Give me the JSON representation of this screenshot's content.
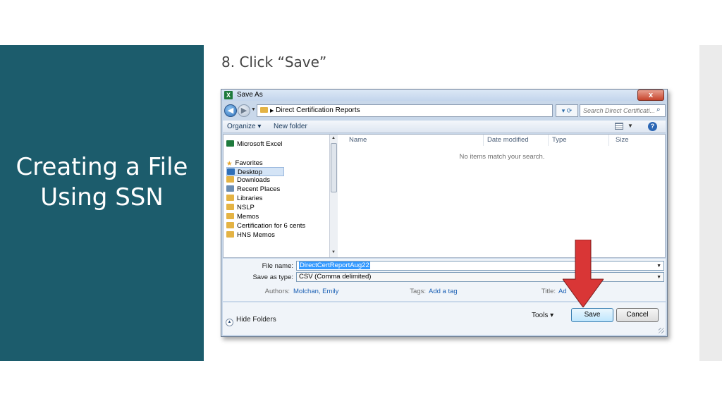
{
  "slide": {
    "title": "Creating a File Using SSN",
    "step": "8. Click “Save”"
  },
  "dialog": {
    "title": "Save As",
    "close_label": "x",
    "breadcrumb": "Direct Certification Reports",
    "search_placeholder": "Search Direct Certificati...",
    "toolbar": {
      "organize": "Organize ▾",
      "new_folder": "New folder"
    },
    "nav_items": [
      {
        "label": "Microsoft Excel",
        "icon": "excel-icon",
        "color": "#1e7a3c"
      },
      {
        "label": "Favorites",
        "icon": "star-icon",
        "color": "#e7a52a"
      },
      {
        "label": "Desktop",
        "icon": "desktop-icon",
        "color": "#2e6fb8"
      },
      {
        "label": "Downloads",
        "icon": "downloads-icon",
        "color": "#e4b344"
      },
      {
        "label": "Recent Places",
        "icon": "recent-places-icon",
        "color": "#6b8db3"
      },
      {
        "label": "Libraries",
        "icon": "libraries-icon",
        "color": "#e4b344"
      },
      {
        "label": "NSLP",
        "icon": "folder-icon",
        "color": "#e4b344"
      },
      {
        "label": "Memos",
        "icon": "folder-icon",
        "color": "#e4b344"
      },
      {
        "label": "Certification for 6 cents",
        "icon": "folder-icon",
        "color": "#e4b344"
      },
      {
        "label": "HNS Memos",
        "icon": "folder-icon",
        "color": "#e4b344"
      }
    ],
    "columns": [
      "Name",
      "Date modified",
      "Type",
      "Size"
    ],
    "empty_message": "No items match your search.",
    "file_name_label": "File name:",
    "file_name_value": "DirectCertReportAug22",
    "save_type_label": "Save as type:",
    "save_type_value": "CSV (Comma delimited)",
    "authors_label": "Authors:",
    "authors_value": "Molchan, Emily",
    "tags_label": "Tags:",
    "tags_value": "Add a tag",
    "title_label": "Title:",
    "title_value": "Ad",
    "hide_folders": "Hide Folders",
    "tools": "Tools ▾",
    "save_button": "Save",
    "cancel_button": "Cancel"
  },
  "colors": {
    "slide_panel": "#1c5c6c",
    "arrow": "#d93636",
    "link": "#1a5fb4"
  }
}
